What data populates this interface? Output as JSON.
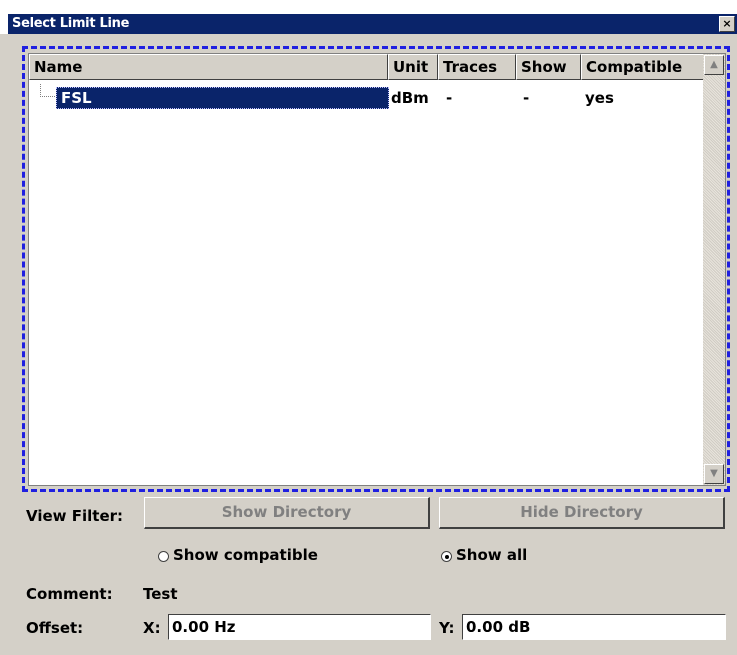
{
  "window": {
    "title": "Select Limit Line",
    "close": "×"
  },
  "table": {
    "columns": [
      "Name",
      "Unit",
      "Traces",
      "Show",
      "Compatible"
    ],
    "rows": [
      {
        "name": "FSL",
        "unit": "dBm",
        "traces": "-",
        "show": "-",
        "compatible": "yes"
      }
    ]
  },
  "scrollbar": {
    "up": "▲",
    "down": "▼"
  },
  "view_filter": {
    "label": "View Filter:",
    "show_directory": "Show Directory",
    "hide_directory": "Hide Directory",
    "show_compatible": "Show compatible",
    "show_all": "Show all",
    "selected": "Show all"
  },
  "comment": {
    "label": "Comment:",
    "value": "Test"
  },
  "offset": {
    "label": "Offset:",
    "x_label": "X:",
    "x_value": "0.00 Hz",
    "y_label": "Y:",
    "y_value": "0.00 dB"
  }
}
